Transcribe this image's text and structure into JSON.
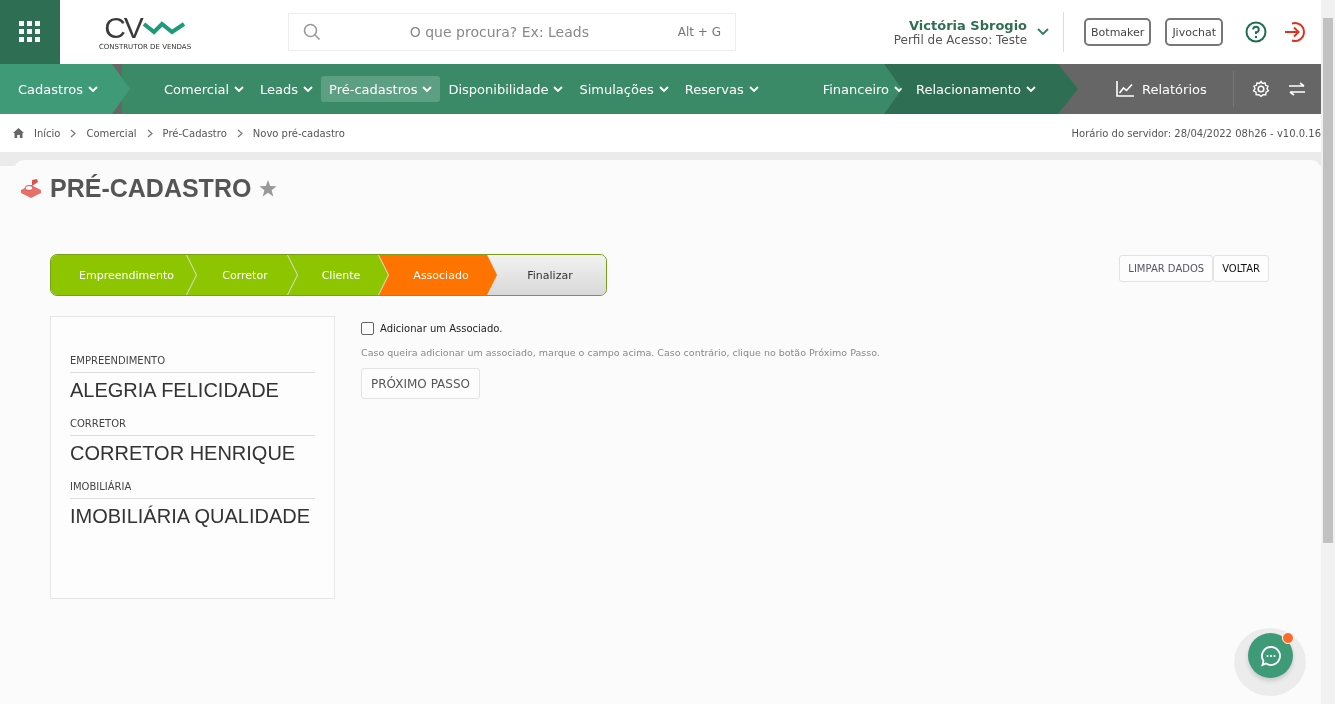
{
  "header": {
    "logo_text": "CV",
    "logo_subtitle": "CONSTRUTOR DE VENDAS",
    "search": {
      "placeholder": "O que procura? Ex: Leads",
      "shortcut": "Alt + G"
    },
    "user": {
      "name": "Victória Sbrogio",
      "profile": "Perfil de Acesso: Teste"
    },
    "buttons": [
      "Botmaker",
      "Jivochat"
    ]
  },
  "nav": {
    "segments": [
      {
        "kind": "light",
        "items": [
          {
            "label": "Cadastros",
            "selected": false
          }
        ]
      },
      {
        "kind": "mid",
        "items": [
          {
            "label": "Comercial",
            "selected": false
          },
          {
            "label": "Leads",
            "selected": false
          },
          {
            "label": "Pré-cadastros",
            "selected": true
          },
          {
            "label": "Disponibilidade",
            "selected": false
          },
          {
            "label": "Simulações",
            "selected": false
          },
          {
            "label": "Reservas",
            "selected": false
          },
          {
            "label": "Financeiro",
            "selected": false
          }
        ]
      },
      {
        "kind": "dark",
        "items": [
          {
            "label": "Relacionamento",
            "selected": false
          }
        ]
      }
    ],
    "reports": "Relatórios"
  },
  "breadcrumb": [
    "Início",
    "Comercial",
    "Pré-Cadastro",
    "Novo pré-cadastro"
  ],
  "server_time": "Horário do servidor: 28/04/2022 08h26 - v10.0.16",
  "page_title": "PRÉ-CADASTRO",
  "steps": [
    {
      "label": "Empreendimento",
      "kind": "done"
    },
    {
      "label": "Corretor",
      "kind": "done"
    },
    {
      "label": "Cliente",
      "kind": "done"
    },
    {
      "label": "Associado",
      "kind": "current"
    },
    {
      "label": "Finalizar",
      "kind": "pending"
    }
  ],
  "actions": [
    "LIMPAR DADOS",
    "VOLTAR"
  ],
  "summary": [
    {
      "label": "EMPREENDIMENTO",
      "value": "ALEGRIA FELICIDADE"
    },
    {
      "label": "CORRETOR",
      "value": "CORRETOR HENRIQUE"
    },
    {
      "label": "IMOBILIÁRIA",
      "value": "IMOBILIÁRIA QUALIDADE"
    }
  ],
  "form": {
    "checkbox": {
      "label": "Adicionar um Associado.",
      "checked": false
    },
    "hint": "Caso queira adicionar um associado, marque o campo acima. Caso contrário, clique no botão Próximo Passo.",
    "next_button": "PRÓXIMO PASSO"
  },
  "chat": {
    "unread": true
  }
}
